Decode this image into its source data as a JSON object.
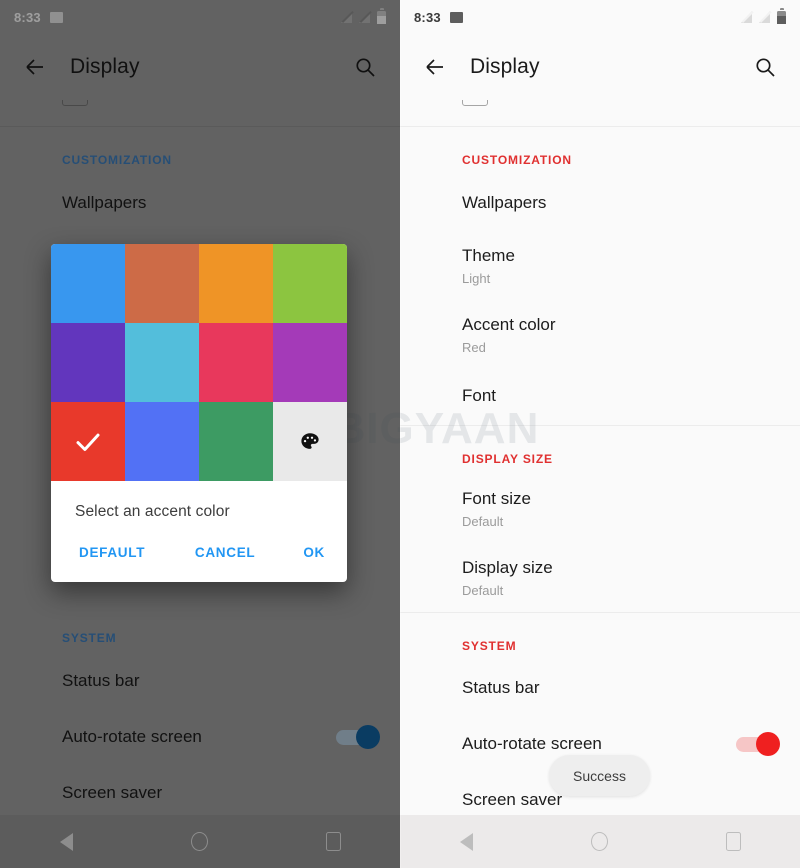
{
  "status_bar": {
    "time": "8:33",
    "icons": [
      "image-icon",
      "signal-off-icon",
      "signal-off-icon",
      "battery-icon"
    ]
  },
  "app_bar": {
    "back_icon": "arrow-left-icon",
    "title": "Display",
    "search_icon": "search-icon"
  },
  "left_screen": {
    "accent_hex": "#3e7fbf",
    "theme": "dimmed",
    "sections": [
      {
        "header": "CUSTOMIZATION",
        "rows": [
          {
            "label": "Wallpapers",
            "sub": ""
          }
        ]
      },
      {
        "header": "SYSTEM",
        "rows": [
          {
            "label": "Status bar",
            "sub": ""
          },
          {
            "label": "Auto-rotate screen",
            "sub": "",
            "toggle": "on"
          },
          {
            "label": "Screen saver",
            "sub": ""
          }
        ]
      }
    ]
  },
  "right_screen": {
    "accent_hex": "#e03030",
    "theme": "light",
    "sections": [
      {
        "header": "CUSTOMIZATION",
        "rows": [
          {
            "label": "Wallpapers",
            "sub": ""
          },
          {
            "label": "Theme",
            "sub": "Light"
          },
          {
            "label": "Accent color",
            "sub": "Red"
          },
          {
            "label": "Font",
            "sub": ""
          }
        ]
      },
      {
        "header": "DISPLAY SIZE",
        "rows": [
          {
            "label": "Font size",
            "sub": "Default"
          },
          {
            "label": "Display size",
            "sub": "Default"
          }
        ]
      },
      {
        "header": "SYSTEM",
        "rows": [
          {
            "label": "Status bar",
            "sub": ""
          },
          {
            "label": "Auto-rotate screen",
            "sub": "",
            "toggle": "on"
          },
          {
            "label": "Screen saver",
            "sub": ""
          }
        ]
      }
    ],
    "toast": {
      "message": "Success"
    }
  },
  "dialog": {
    "title": "Select an accent color",
    "buttons": {
      "default": "DEFAULT",
      "cancel": "CANCEL",
      "ok": "OK"
    },
    "button_color": "#2196f3",
    "swatches": [
      {
        "name": "blue",
        "hex": "#3897ef",
        "selected": false
      },
      {
        "name": "terracotta",
        "hex": "#cd6b47",
        "selected": false
      },
      {
        "name": "orange",
        "hex": "#ef9426",
        "selected": false
      },
      {
        "name": "light-green",
        "hex": "#8cc540",
        "selected": false
      },
      {
        "name": "deep-purple",
        "hex": "#6236bd",
        "selected": false
      },
      {
        "name": "cyan",
        "hex": "#53bedb",
        "selected": false
      },
      {
        "name": "pink-red",
        "hex": "#e8385c",
        "selected": false
      },
      {
        "name": "magenta-purple",
        "hex": "#a43ab8",
        "selected": false
      },
      {
        "name": "red",
        "hex": "#e8392b",
        "selected": true
      },
      {
        "name": "indigo-blue",
        "hex": "#5271f5",
        "selected": false
      },
      {
        "name": "green",
        "hex": "#3d9b63",
        "selected": false
      },
      {
        "name": "custom-picker",
        "hex": "#e9e9e9",
        "selected": false,
        "icon": "palette-icon"
      }
    ]
  },
  "nav_bar": {
    "back_icon": "triangle-back-icon",
    "home_icon": "circle-home-icon",
    "recents_icon": "square-recents-icon"
  },
  "watermark": {
    "text": "MOBIGYAAN"
  }
}
